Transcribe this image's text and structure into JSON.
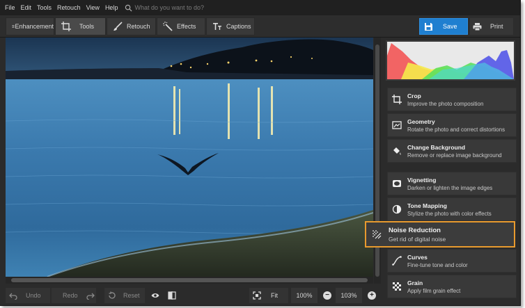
{
  "menubar": {
    "items": [
      "File",
      "Edit",
      "Tools",
      "Retouch",
      "View",
      "Help"
    ],
    "search_placeholder": "What do you want to do?"
  },
  "toolbar": {
    "tabs": [
      {
        "label": "Enhancement",
        "icon": "sliders-icon"
      },
      {
        "label": "Tools",
        "icon": "crop-icon"
      },
      {
        "label": "Retouch",
        "icon": "brush-icon"
      },
      {
        "label": "Effects",
        "icon": "magic-wand-icon"
      },
      {
        "label": "Captions",
        "icon": "text-icon"
      }
    ],
    "active_tab": "Tools",
    "save_label": "Save",
    "print_label": "Print"
  },
  "bottombar": {
    "undo_label": "Undo",
    "redo_label": "Redo",
    "reset_label": "Reset",
    "fit_label": "Fit",
    "zoom_100": "100%",
    "zoom_current": "103%",
    "zoom_out": "−",
    "zoom_in": "+"
  },
  "tools": [
    {
      "title": "Crop",
      "desc": "Improve the photo composition",
      "icon": "crop-icon"
    },
    {
      "title": "Geometry",
      "desc": "Rotate the photo and correct distortions",
      "icon": "geometry-icon"
    },
    {
      "title": "Change Background",
      "desc": "Remove or replace image background",
      "icon": "paint-bucket-icon"
    },
    {
      "title": "Vignetting",
      "desc": "Darken or lighten the image edges",
      "icon": "vignette-icon"
    },
    {
      "title": "Tone Mapping",
      "desc": "Stylize the photo with color effects",
      "icon": "tone-mapping-icon"
    },
    {
      "title": "Noise Reduction",
      "desc": "Get rid of digital noise",
      "icon": "noise-icon"
    },
    {
      "title": "Curves",
      "desc": "Fine-tune tone and color",
      "icon": "curves-icon"
    },
    {
      "title": "Grain",
      "desc": "Apply film grain effect",
      "icon": "grain-icon"
    }
  ],
  "highlighted_tool": "Noise Reduction",
  "colors": {
    "accent_blue": "#1f7fd0",
    "highlight_orange": "#e89a2e",
    "panel_bg": "#2b2b2b"
  }
}
